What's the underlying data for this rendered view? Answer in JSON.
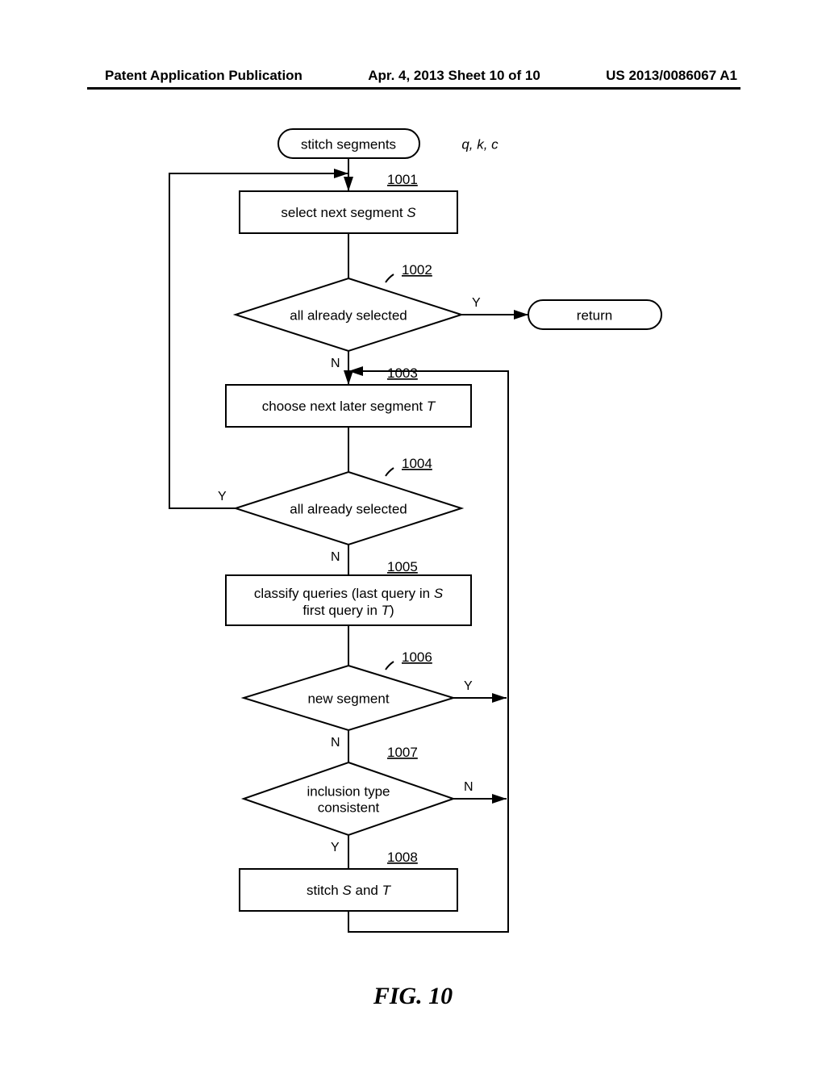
{
  "header": {
    "left": "Patent Application Publication",
    "center": "Apr. 4, 2013  Sheet 10 of 10",
    "right": "US 2013/0086067 A1"
  },
  "terminals": {
    "start": "stitch segments",
    "params": "q, k, c",
    "return": "return"
  },
  "steps": {
    "s1001": {
      "ref": "1001",
      "text": "select next segment ",
      "var": "S"
    },
    "s1002": {
      "ref": "1002",
      "text": "all already selected"
    },
    "s1003": {
      "ref": "1003",
      "text": "choose next later segment ",
      "var": "T"
    },
    "s1004": {
      "ref": "1004",
      "text": "all already selected"
    },
    "s1005": {
      "ref": "1005",
      "line1a": "classify queries (last query in ",
      "var1": "S",
      "line2a": "first query in ",
      "var2": "T",
      "line2b": ")"
    },
    "s1006": {
      "ref": "1006",
      "text": "new segment"
    },
    "s1007": {
      "ref": "1007",
      "line1": "inclusion type",
      "line2": "consistent"
    },
    "s1008": {
      "ref": "1008",
      "text1": "stitch ",
      "var1": "S",
      "text2": " and ",
      "var2": "T"
    }
  },
  "labels": {
    "Y": "Y",
    "N": "N"
  },
  "figure": "FIG. 10"
}
